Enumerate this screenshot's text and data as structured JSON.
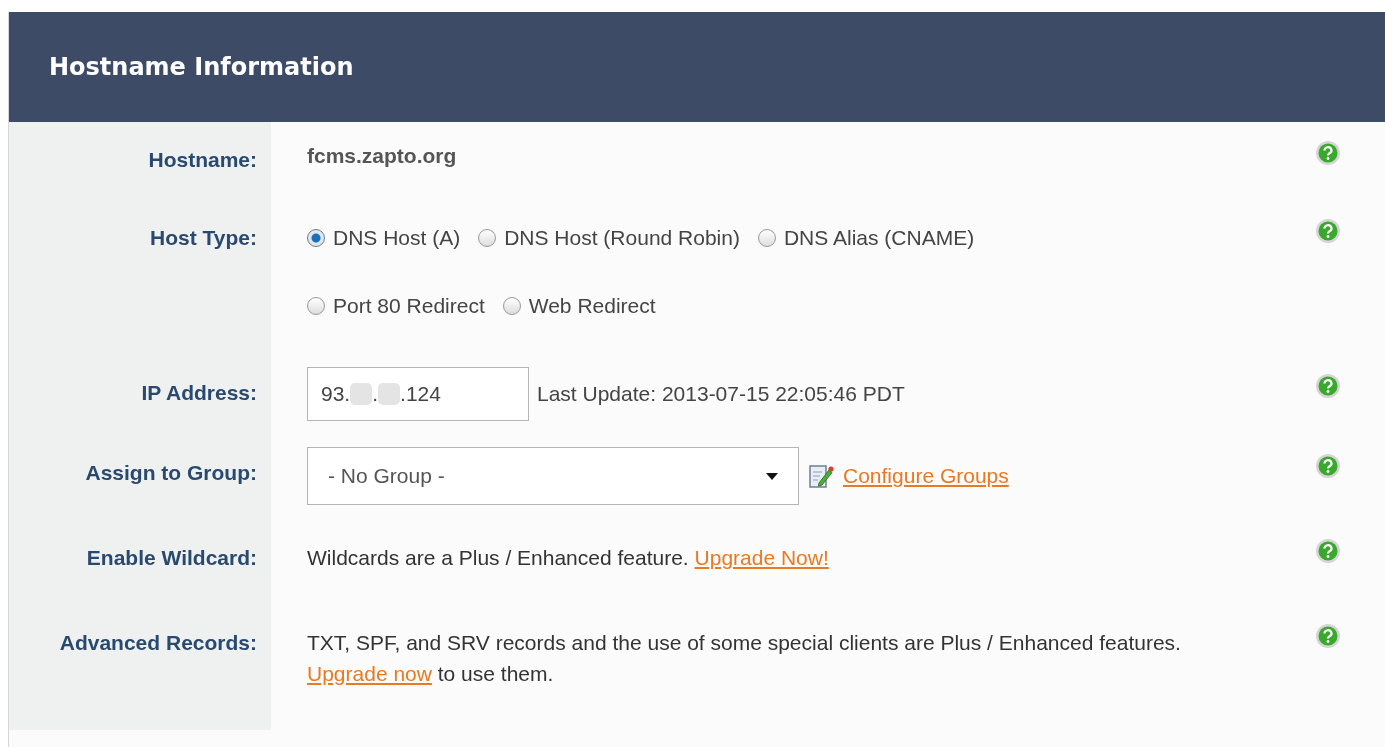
{
  "panel": {
    "title": "Hostname Information"
  },
  "rows": [
    {
      "kind": "static",
      "label": "Hostname:",
      "value": "fcms.zapto.org"
    },
    {
      "kind": "radios",
      "label": "Host Type:",
      "options": [
        {
          "label": "DNS Host (A)",
          "selected": true
        },
        {
          "label": "DNS Host (Round Robin)",
          "selected": false
        },
        {
          "label": "DNS Alias (CNAME)",
          "selected": false
        },
        {
          "label": "Port 80 Redirect",
          "selected": false
        },
        {
          "label": "Web Redirect",
          "selected": false
        }
      ]
    },
    {
      "kind": "ip",
      "label": "IP Address:",
      "segments": [
        {
          "kind": "text",
          "text": "93."
        },
        {
          "kind": "redacted"
        },
        {
          "kind": "text",
          "text": "."
        },
        {
          "kind": "redacted"
        },
        {
          "kind": "text",
          "text": ".124"
        }
      ],
      "note": "Last Update: 2013-07-15 22:05:46 PDT"
    },
    {
      "kind": "select",
      "label": "Assign to Group:",
      "value": "- No Group -",
      "link": "Configure Groups"
    },
    {
      "kind": "text",
      "label": "Enable Wildcard:",
      "parts": [
        {
          "kind": "text",
          "text": "Wildcards are a Plus / Enhanced feature."
        },
        {
          "kind": "link",
          "text": "Upgrade Now!"
        }
      ]
    },
    {
      "kind": "text",
      "label": "Advanced Records:",
      "parts": [
        {
          "kind": "text",
          "text": "TXT, SPF, and SRV records and the use of some special clients are Plus / Enhanced features."
        },
        {
          "kind": "link",
          "text": "Upgrade now"
        },
        {
          "kind": "text",
          "text": "to use them."
        }
      ]
    }
  ]
}
